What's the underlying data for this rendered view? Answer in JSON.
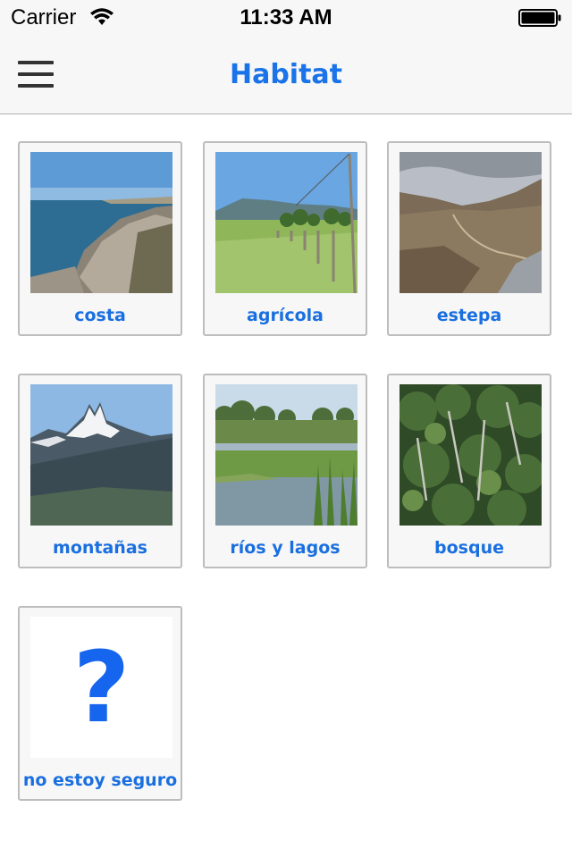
{
  "status": {
    "carrier": "Carrier",
    "time": "11:33 AM"
  },
  "header": {
    "title": "Habitat"
  },
  "habitats": [
    {
      "label": "costa",
      "image": "coast-photo"
    },
    {
      "label": "agrícola",
      "image": "farmland-photo"
    },
    {
      "label": "estepa",
      "image": "steppe-photo"
    },
    {
      "label": "montañas",
      "image": "mountains-photo"
    },
    {
      "label": "ríos y lagos",
      "image": "wetland-photo"
    },
    {
      "label": "bosque",
      "image": "forest-photo"
    },
    {
      "label": "no estoy seguro",
      "image": "question-mark-icon"
    }
  ],
  "question_mark": "?",
  "colors": {
    "accent": "#1a6fe0",
    "nav_bg": "#f7f7f7",
    "card_bg": "#f7f7f7",
    "card_border": "#bdbdbd"
  }
}
